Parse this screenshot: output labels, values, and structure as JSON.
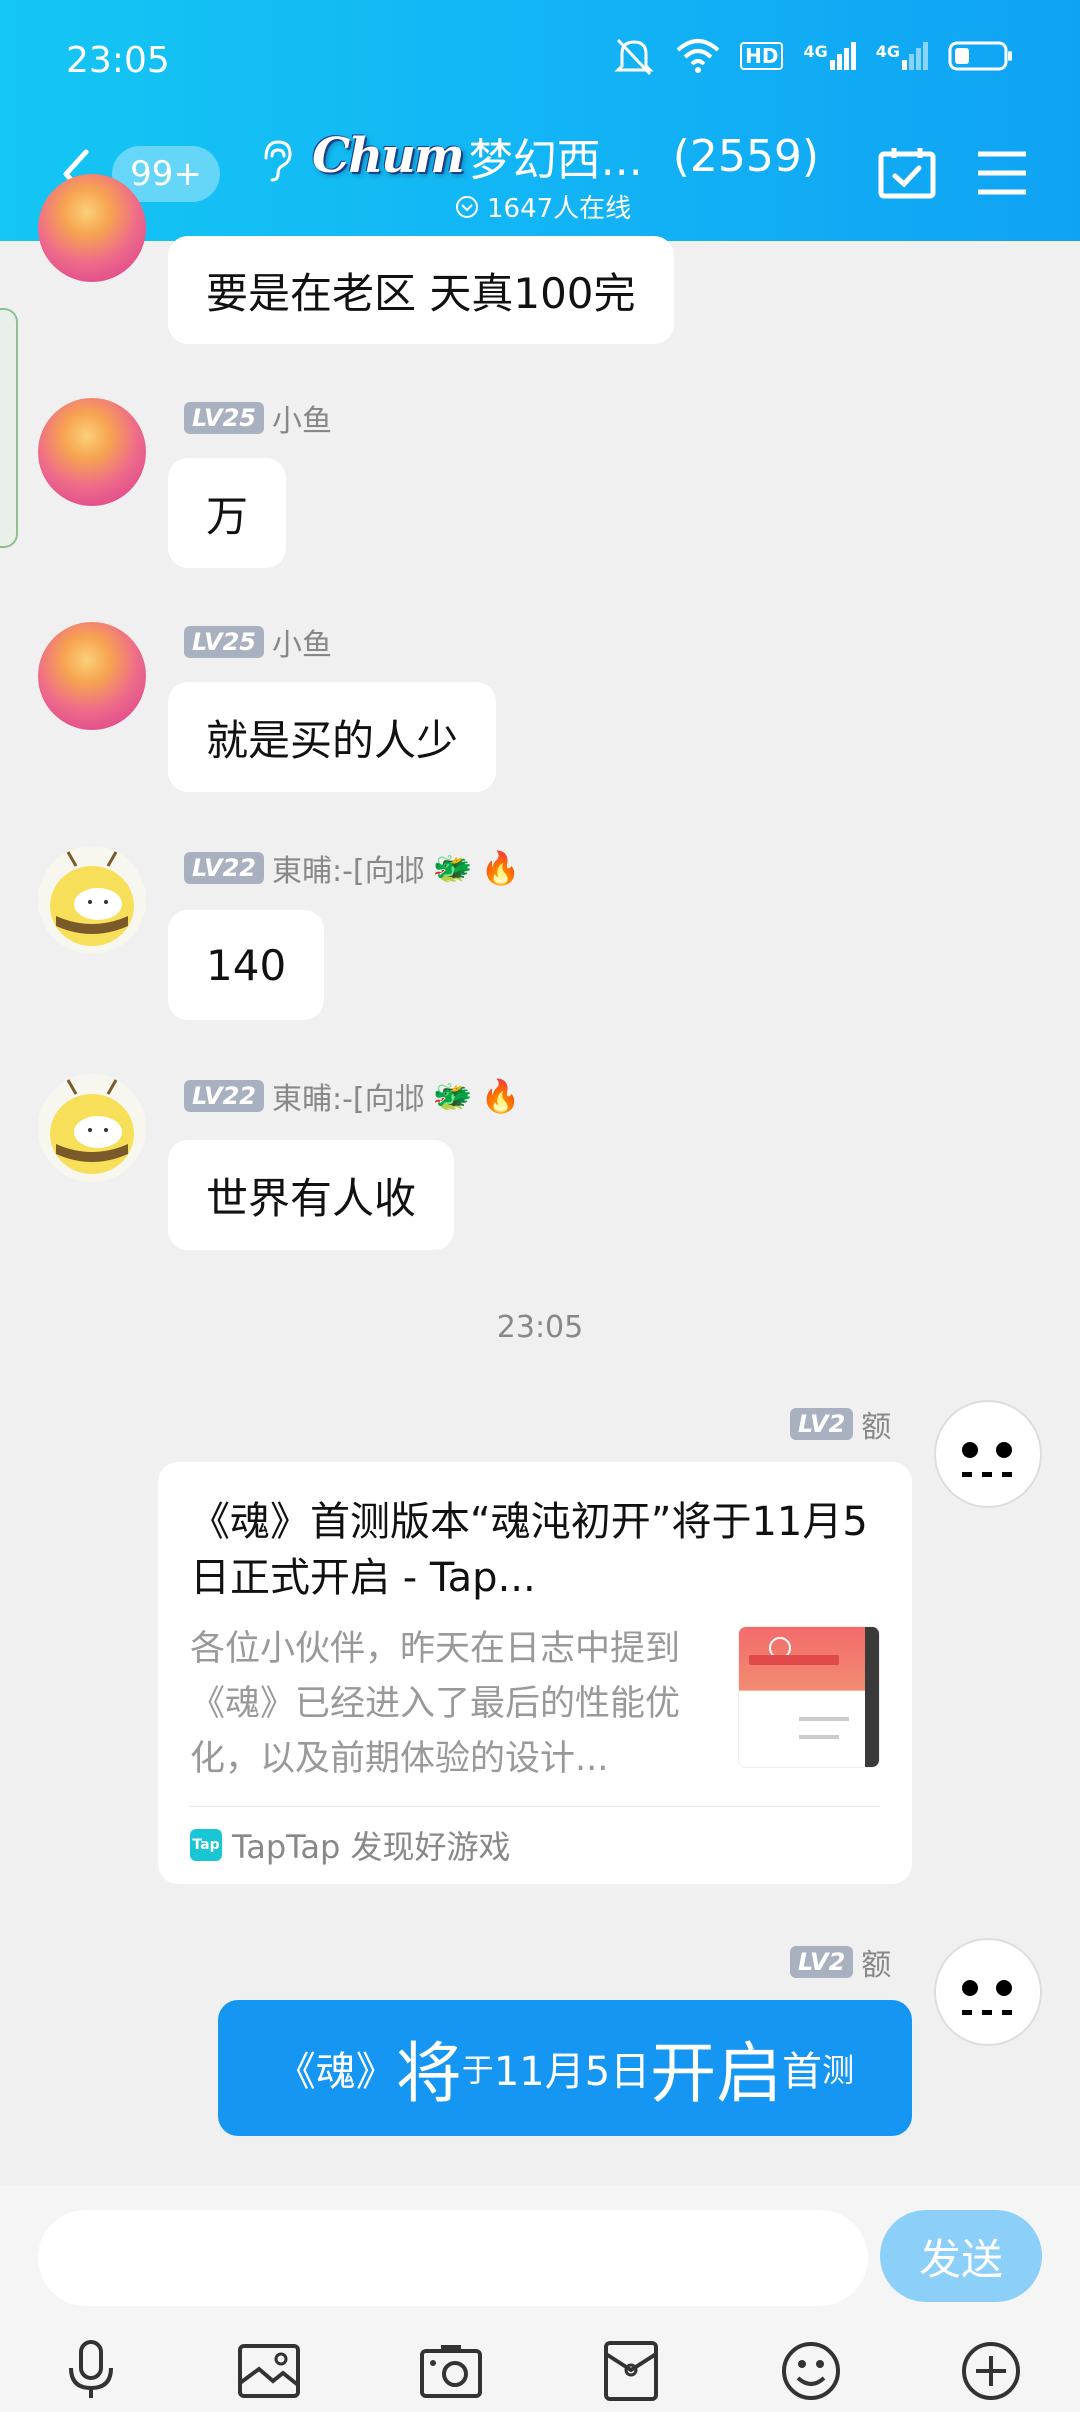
{
  "status_bar": {
    "time": "23:05",
    "hd_label": "HD",
    "net1": "4G",
    "net2": "4G"
  },
  "header": {
    "unread": "99+",
    "logo_text": "Chum",
    "title": "梦幻西...",
    "member_count": "(2559)",
    "online_text": "1647人在线"
  },
  "messages": [
    {
      "text": "要是在老区 天真100完"
    },
    {
      "level": "LV25",
      "name": "小鱼",
      "text": "万"
    },
    {
      "level": "LV25",
      "name": "小鱼",
      "text": "就是买的人少"
    },
    {
      "level": "LV22",
      "name": "東晡:-[向邶",
      "text": "140"
    },
    {
      "level": "LV22",
      "name": "東晡:-[向邶",
      "text": "世界有人收"
    }
  ],
  "time_separator": "23:05",
  "self_messages": [
    {
      "level": "LV2",
      "name": "额",
      "card": {
        "title": "《魂》首测版本“魂沌初开”将于11月5日正式开启 - Tap...",
        "body": "各位小伙伴，昨天在日志中提到《魂》已经进入了最后的性能优化，以及前期体验的设计...",
        "source_logo": "Tap",
        "source": "TapTap 发现好游戏"
      }
    },
    {
      "level": "LV2",
      "name": "额",
      "rich_parts": [
        "《魂》",
        "将",
        "于",
        "11月5日",
        "开启",
        "首",
        "测"
      ]
    }
  ],
  "input": {
    "placeholder": "",
    "send_label": "发送"
  },
  "toolbar": [
    "mic-icon",
    "image-icon",
    "camera-icon",
    "red-packet-icon",
    "emoji-icon",
    "plus-icon"
  ],
  "colors": {
    "header": "#12b3f5",
    "bubble_self": "#1696f3",
    "send_button": "#8ccff8",
    "background": "#f0f0f0"
  }
}
